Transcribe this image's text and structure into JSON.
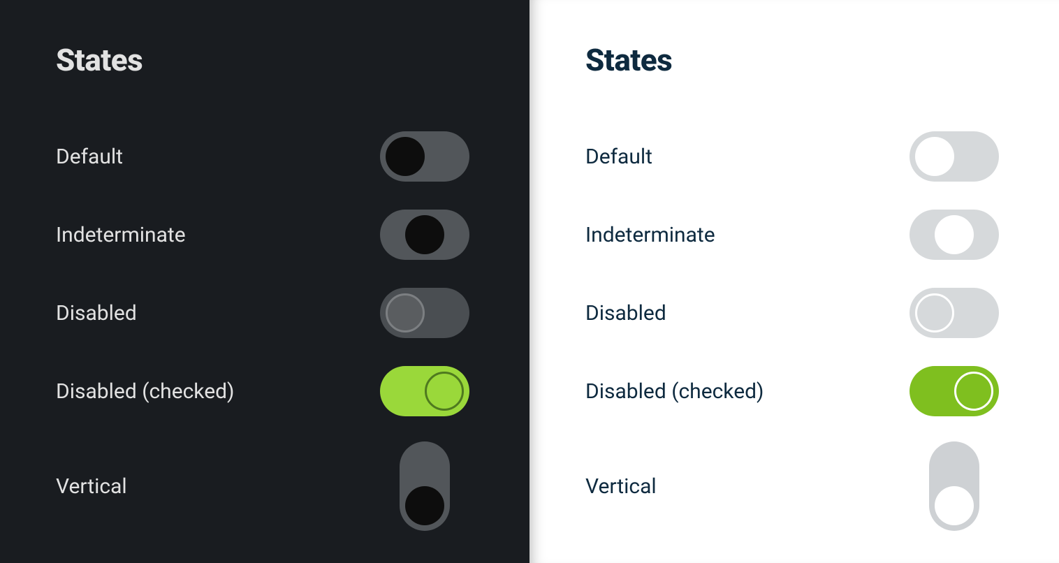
{
  "heading": "States",
  "rows": {
    "default": {
      "label": "Default"
    },
    "indeterminate": {
      "label": "Indeterminate"
    },
    "disabled": {
      "label": "Disabled"
    },
    "disabled_checked": {
      "label": "Disabled (checked)"
    },
    "vertical": {
      "label": "Vertical"
    }
  },
  "colors": {
    "dark_bg": "#191c20",
    "light_bg": "#ffffff",
    "dark_text": "#e2e2e2",
    "light_text": "#0e2a3f",
    "accent_green_dark": "#9ad83a",
    "accent_green_light": "#7fbf1f",
    "track_off_dark": "#52565a",
    "track_off_light": "#d6d9db"
  }
}
